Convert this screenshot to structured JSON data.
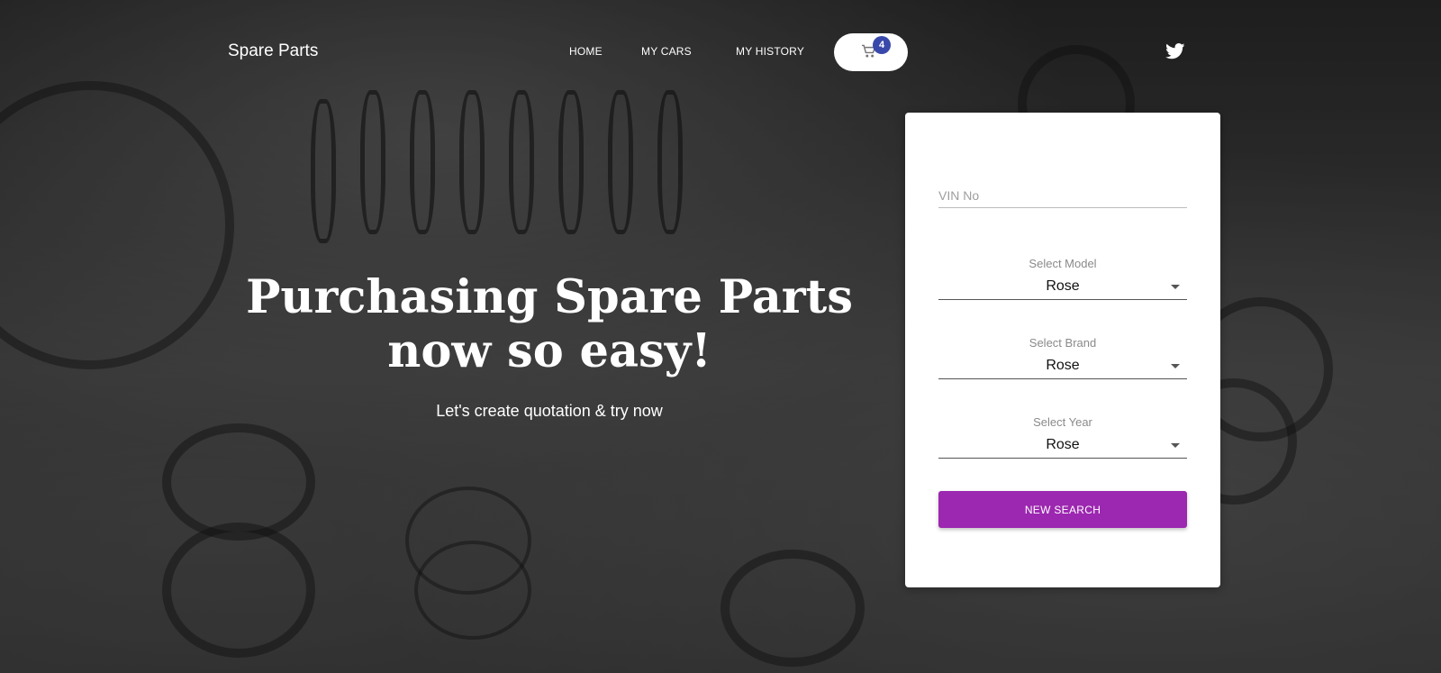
{
  "nav": {
    "brand": "Spare Parts",
    "links": [
      "HOME",
      "MY CARS",
      "MY HISTORY"
    ],
    "cart_count": "4",
    "cart_icon": "shopping-cart-icon",
    "social_icon": "twitter-icon"
  },
  "hero": {
    "headline_line1": "Purchasing Spare Parts",
    "headline_line2": "now so easy!",
    "subline": "Let's create quotation & try now"
  },
  "form": {
    "vin_placeholder": "VIN No",
    "vin_value": "",
    "model_label": "Select Model",
    "model_value": "Rose",
    "brand_label": "Select Brand",
    "brand_value": "Rose",
    "year_label": "Select Year",
    "year_value": "Rose",
    "search_button": "NEW SEARCH"
  },
  "colors": {
    "accent": "#9c27b0",
    "badge": "#3949ab"
  }
}
